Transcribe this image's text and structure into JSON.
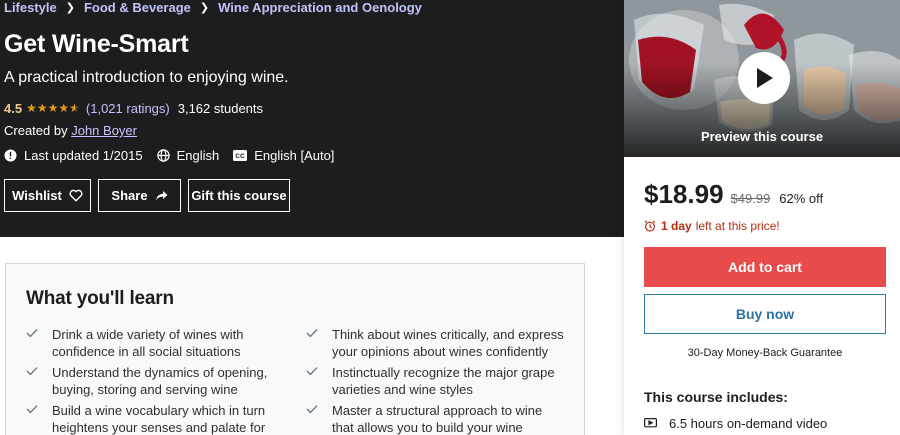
{
  "breadcrumb": [
    "Lifestyle",
    "Food & Beverage",
    "Wine Appreciation and Oenology"
  ],
  "course": {
    "title": "Get Wine-Smart",
    "subtitle": "A practical introduction to enjoying wine.",
    "rating": "4.5",
    "stars_value": 4.5,
    "stars_max": 5,
    "ratings_count": "(1,021 ratings)",
    "students": "3,162 students",
    "created_by_label": "Created by",
    "instructor": "John Boyer",
    "last_updated": "Last updated 1/2015",
    "language": "English",
    "captions": "English [Auto]"
  },
  "actions": {
    "wishlist": "Wishlist",
    "share": "Share",
    "gift": "Gift this course"
  },
  "sidebar": {
    "preview_label": "Preview this course",
    "price": "$18.99",
    "original_price": "$49.99",
    "discount": "62% off",
    "timer_bold": "1 day",
    "timer_rest": "left at this price!",
    "add_to_cart": "Add to cart",
    "buy_now": "Buy now",
    "guarantee": "30-Day Money-Back Guarantee",
    "includes_title": "This course includes:",
    "includes": [
      "6.5 hours on-demand video"
    ]
  },
  "learn": {
    "heading": "What you'll learn",
    "items": [
      "Drink a wide variety of wines with confidence in all social situations",
      "Think about wines critically, and express your opinions about wines confidently",
      "Understand the dynamics of opening, buying, storing and serving wine",
      "Instinctually recognize the major grape varieties and wine styles",
      "Build a wine vocabulary which in turn heightens your senses and palate for wine",
      "Master a structural approach to wine that allows you to build your wine knowledge for"
    ]
  },
  "colors": {
    "hero_bg": "#1c1d1f",
    "link_purple": "#cec0fc",
    "star": "#e59819",
    "cart_red": "#e84b4b",
    "buy_blue": "#2b74a1",
    "timer_red": "#b32d0f"
  },
  "icons": [
    "chevron-right-icon",
    "star-icon",
    "alert-icon",
    "globe-icon",
    "captions-icon",
    "heart-icon",
    "share-arrow-icon",
    "play-icon",
    "alarm-clock-icon",
    "video-icon",
    "check-icon"
  ]
}
